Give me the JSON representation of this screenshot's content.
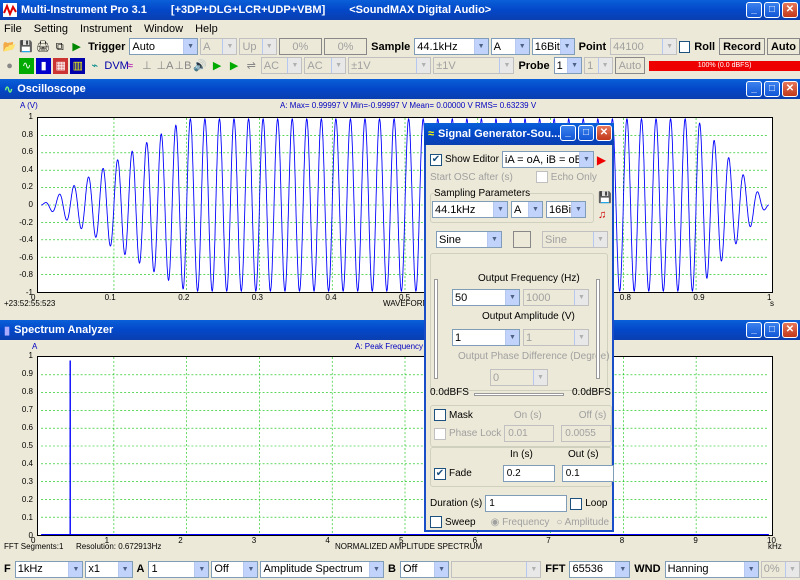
{
  "app": {
    "title": "Multi-Instrument Pro 3.1",
    "modules": "[+3DP+DLG+LCR+UDP+VBM]",
    "device": "<SoundMAX Digital Audio>"
  },
  "menu": [
    "File",
    "Setting",
    "Instrument",
    "Window",
    "Help"
  ],
  "toolbar1": {
    "trigger_label": "Trigger",
    "trigger_mode": "Auto",
    "channel": "A",
    "direction": "Up",
    "pct1": "0%",
    "pct2": "0%",
    "sample_label": "Sample",
    "sample_rate": "44.1kHz",
    "sample_channel": "A",
    "bits": "16Bit",
    "point_label": "Point",
    "points": "44100",
    "roll": "Roll",
    "record": "Record",
    "auto": "Auto"
  },
  "toolbar2": {
    "coupling_a": "AC",
    "coupling_b": "AC",
    "range_a": "±1V",
    "range_b": "±1V",
    "probe_label": "Probe",
    "probe_value": "1",
    "auto": "Auto",
    "level_text": "100% (0.0 dBFS)"
  },
  "oscilloscope": {
    "title": "Oscilloscope",
    "y_unit": "A (V)",
    "stats": "A: Max= 0.99997 V  Min=-0.99997 V  Mean= 0.00000 V  RMS= 0.63239 V",
    "time_stamp": "+23:52:55:523",
    "x_label": "WAVEFORM",
    "x_unit": "s",
    "y_ticks": [
      "1",
      "0.8",
      "0.6",
      "0.4",
      "0.2",
      "0",
      "-0.2",
      "-0.4",
      "-0.6",
      "-0.8",
      "-1"
    ],
    "x_ticks": [
      "0",
      "0.1",
      "0.2",
      "0.3",
      "0.4",
      "0.5",
      "0.6",
      "0.7",
      "0.8",
      "0.9",
      "1"
    ]
  },
  "spectrum": {
    "title": "Spectrum Analyzer",
    "y_unit": "A",
    "header": "A: Peak Frequency",
    "fft_segments": "FFT Segments:1",
    "resolution": "Resolution: 0.672913Hz",
    "x_label": "NORMALIZED AMPLITUDE SPECTRUM",
    "x_unit": "kHz",
    "y_ticks": [
      "1",
      "0.9",
      "0.8",
      "0.7",
      "0.6",
      "0.5",
      "0.4",
      "0.3",
      "0.2",
      "0.1",
      "0"
    ],
    "x_ticks": [
      "0",
      "1",
      "2",
      "3",
      "4",
      "5",
      "6",
      "7",
      "8",
      "9",
      "10"
    ]
  },
  "siggen": {
    "title": "Signal Generator-Sou...",
    "show_editor": "Show Editor",
    "editor_formula": "iA = oA, iB = oB",
    "start_osc": "Start OSC after (s)",
    "echo_only": "Echo Only",
    "sampling_params": "Sampling Parameters",
    "rate": "44.1kHz",
    "channel": "A",
    "bits": "16Bit",
    "wave_a": "Sine",
    "wave_b": "Sine",
    "out_freq_label": "Output Frequency (Hz)",
    "freq_a": "50",
    "freq_b": "1000",
    "out_amp_label": "Output Amplitude (V)",
    "amp_a": "1",
    "amp_b": "1",
    "phase_label": "Output Phase Difference (Degree)",
    "phase": "0",
    "dbfs_left": "0.0dBFS",
    "dbfs_right": "0.0dBFS",
    "mask": "Mask",
    "on_label": "On (s)",
    "off_label": "Off (s)",
    "phase_lock": "Phase Lock",
    "mask_on": "0.01",
    "mask_off": "0.0055",
    "fade": "Fade",
    "in_label": "In (s)",
    "out_label": "Out (s)",
    "fade_in": "0.2",
    "fade_out": "0.1",
    "duration_label": "Duration (s)",
    "duration": "1",
    "loop": "Loop",
    "sweep": "Sweep",
    "frequency": "Frequency",
    "amplitude": "Amplitude"
  },
  "bottom": {
    "freq_range": "1kHz",
    "zoom": "x1",
    "channel": "A",
    "chan_num": "1",
    "opt1": "Off",
    "mode": "Amplitude Spectrum",
    "b_label": "B",
    "opt2": "Off",
    "fft_label": "FFT",
    "fft_size": "65536",
    "wnd_label": "WND",
    "window": "Hanning",
    "overlap": "0%"
  },
  "colors": {
    "title_blue": "#0347c8",
    "trace": "#0000ff",
    "grid": "#00c000",
    "level_bar": "#ee0000"
  }
}
